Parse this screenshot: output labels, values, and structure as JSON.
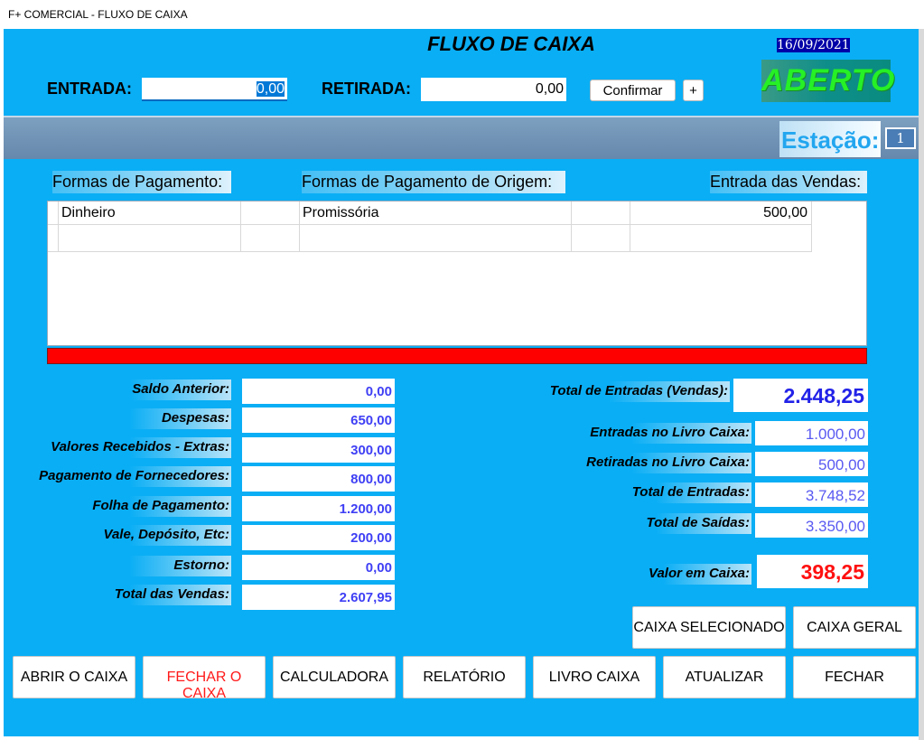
{
  "window": {
    "title": "F+ COMERCIAL - FLUXO DE CAIXA"
  },
  "header": {
    "title": "FLUXO DE CAIXA",
    "date": "16/09/2021",
    "status": "ABERTO",
    "entrada_label": "ENTRADA:",
    "entrada_value": "0,00",
    "retirada_label": "RETIRADA:",
    "retirada_value": "0,00",
    "confirm_label": "Confirmar",
    "plus_label": "+"
  },
  "station": {
    "label": "Estação:",
    "value": "1"
  },
  "grid": {
    "headers": {
      "payment": "Formas de Pagamento:",
      "origin": "Formas de Pagamento de Origem:",
      "sales": "Entrada das Vendas:"
    },
    "rows": [
      {
        "payment": "Dinheiro",
        "origin": "Promissória",
        "sales": "500,00"
      },
      {
        "payment": "",
        "origin": "",
        "sales": ""
      }
    ]
  },
  "left_fields": [
    {
      "label": "Saldo Anterior:",
      "value": "0,00"
    },
    {
      "label": "Despesas:",
      "value": "650,00"
    },
    {
      "label": "Valores Recebidos - Extras:",
      "value": "300,00"
    },
    {
      "label": "Pagamento de Fornecedores:",
      "value": "800,00"
    },
    {
      "label": "Folha de Pagamento:",
      "value": "1.200,00"
    },
    {
      "label": "Vale, Depósito, Etc:",
      "value": "200,00"
    },
    {
      "label": "Estorno:",
      "value": "0,00"
    },
    {
      "label": "Total das Vendas:",
      "value": "2.607,95"
    }
  ],
  "right_fields": {
    "total_entradas_vendas": {
      "label": "Total de Entradas (Vendas):",
      "value": "2.448,25"
    },
    "entradas_livro": {
      "label": "Entradas no Livro Caixa:",
      "value": "1.000,00"
    },
    "retiradas_livro": {
      "label": "Retiradas no Livro Caixa:",
      "value": "500,00"
    },
    "total_entradas": {
      "label": "Total de Entradas:",
      "value": "3.748,52"
    },
    "total_saidas": {
      "label": "Total de Saídas:",
      "value": "3.350,00"
    },
    "valor_caixa": {
      "label": "Valor em Caixa:",
      "value": "398,25"
    }
  },
  "buttons": {
    "caixa_selecionado": "CAIXA SELECIONADO",
    "caixa_geral": "CAIXA GERAL",
    "abrir": "ABRIR O CAIXA",
    "fechar_caixa": "FECHAR O CAIXA",
    "calculadora": "CALCULADORA",
    "relatorio": "RELATÓRIO",
    "livro_caixa": "LIVRO CAIXA",
    "atualizar": "ATUALIZAR",
    "fechar": "FECHAR"
  },
  "colors": {
    "background": "#0aaef5",
    "status_text": "#26f026",
    "value_blue": "#3f3ff5",
    "value_red": "#ff1010",
    "red_bar": "#ff0000"
  }
}
